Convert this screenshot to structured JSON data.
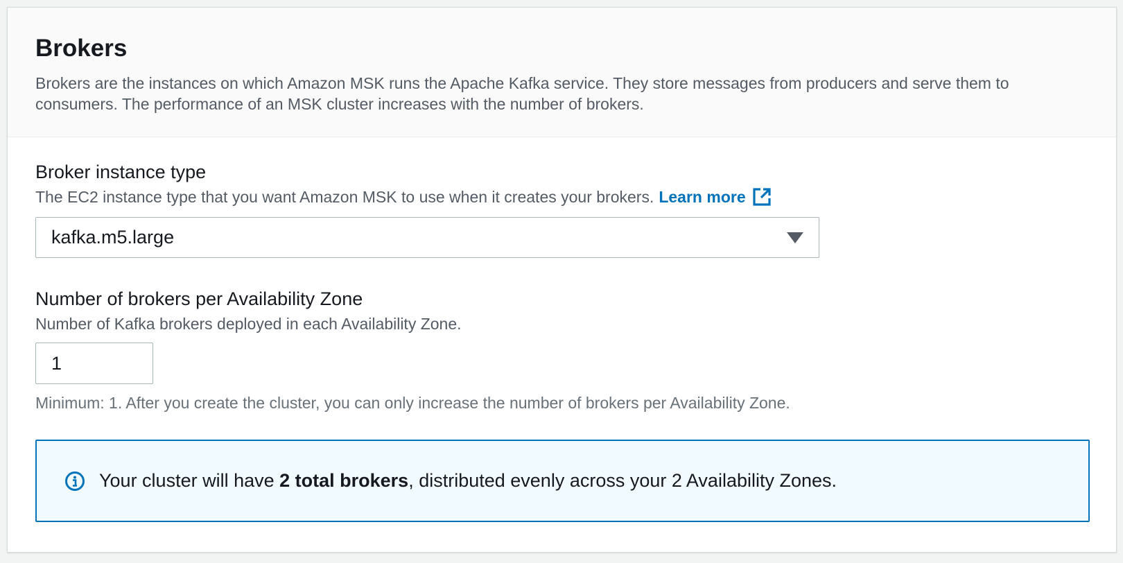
{
  "section": {
    "title": "Brokers",
    "description": "Brokers are the instances on which Amazon MSK runs the Apache Kafka service. They store messages from producers and serve them to consumers. The performance of an MSK cluster increases with the number of brokers."
  },
  "instance_type": {
    "label": "Broker instance type",
    "description": "The EC2 instance type that you want Amazon MSK to use when it creates your brokers.",
    "learn_more": "Learn more",
    "selected_value": "kafka.m5.large"
  },
  "brokers_per_az": {
    "label": "Number of brokers per Availability Zone",
    "description": "Number of Kafka brokers deployed in each Availability Zone.",
    "value": "1",
    "constraint": "Minimum: 1. After you create the cluster, you can only increase the number of brokers per Availability Zone."
  },
  "info_alert": {
    "text_before": "Your cluster will have ",
    "text_bold": "2 total brokers",
    "text_after": ", distributed evenly across your 2 Availability Zones."
  },
  "colors": {
    "link": "#0073bb",
    "alert_border": "#0073bb",
    "alert_background": "#f1faff"
  },
  "icons": {
    "external_link": "external-link-icon",
    "dropdown": "caret-down-icon",
    "info": "info-icon"
  }
}
